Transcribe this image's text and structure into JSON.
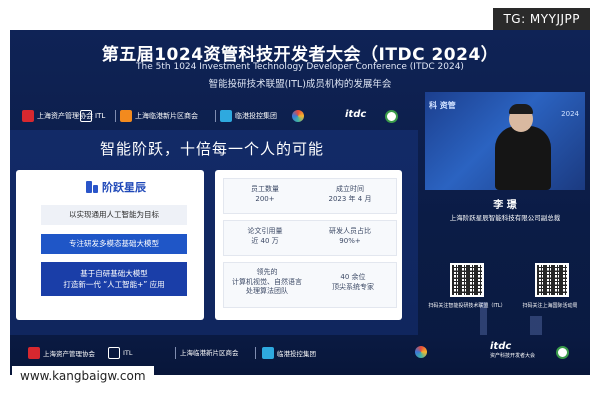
{
  "watermarks": {
    "top": "TG: MYYJJPP",
    "bottom": "www.kangbaigw.com"
  },
  "header": {
    "title_zh": "第五届1024资管科技开发者大会（ITDC 2024）",
    "title_en": "The 5th 1024 Investment Technology Developer Conference (ITDC 2024)",
    "subtitle_zh": "智能投研技术联盟(ITL)成员机构的发展年会"
  },
  "top_logos": {
    "left": [
      "上海资产管理协会",
      "ITL",
      "上海临港新片区商会",
      "临港投控集团"
    ],
    "itdc": "itdc"
  },
  "slide": {
    "heading": "智能阶跃，十倍每一个人的可能",
    "brand": "阶跃星辰",
    "goal": "以实现通用人工智能为目标",
    "pill1": "专注研发多模态基础大模型",
    "pill2_line1": "基于自研基础大模型",
    "pill2_line2": "打造新一代 “人工智能+” 应用",
    "stats": {
      "employees_label": "员工数量",
      "employees_value": "200+",
      "founded_label": "成立时间",
      "founded_value": "2023 年 4 月",
      "papers_label": "论文引用量",
      "papers_value": "近 40 万",
      "rd_label": "研发人员占比",
      "rd_value": "90%+",
      "team_line1": "领先的",
      "team_line2": "计算机视觉、自然语言",
      "team_line3": "处理算法团队",
      "experts_line1": "40 余位",
      "experts_line2": "顶尖系统专家"
    }
  },
  "speaker": {
    "name": "李 璟",
    "title": "上海阶跃星辰智能科技有限公司副总裁",
    "video_text": "科 资管",
    "video_year": "2024"
  },
  "qr_codes": {
    "left_label": "扫码关注智能投研技术联盟（ITL）",
    "right_label": "扫码关注上海国际活动周"
  },
  "bottom_logos": {
    "left": [
      "上海资产管理协会",
      "ITL",
      "上海临港新片区商会",
      "临港投控集团"
    ],
    "itdc": "itdc",
    "itdc_sub": "资产科技开发者大会"
  }
}
